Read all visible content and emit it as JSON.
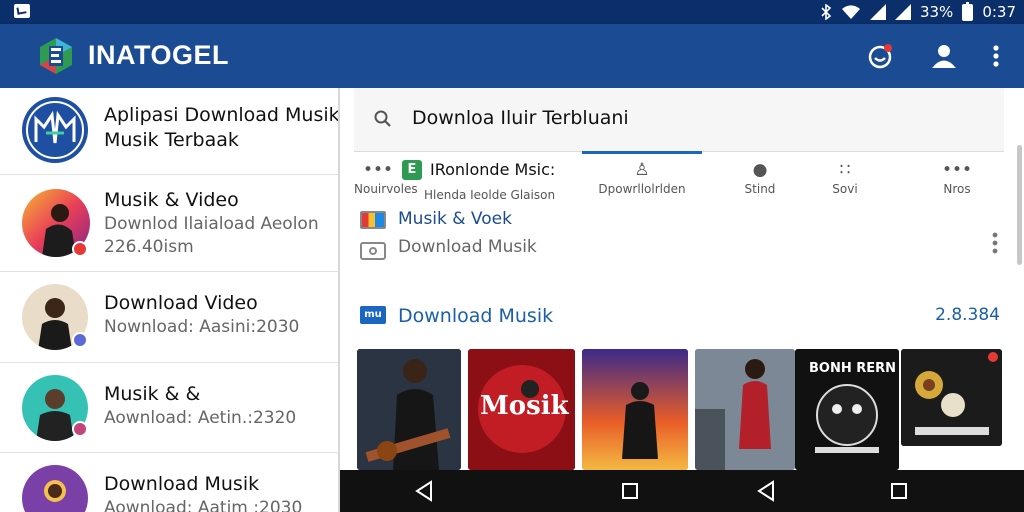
{
  "status_bar": {
    "battery_text": "33%",
    "time": "0:37"
  },
  "app_bar": {
    "title": "INATOGEL"
  },
  "list": [
    {
      "title": "Aplipasi Download Musik",
      "subtitle": "Musik Terbaak",
      "subtitle_line2": ""
    },
    {
      "title": "Musik & Video",
      "subtitle": "Downlod Ilaiaload Aeolon",
      "subtitle_line2": "226.40ism"
    },
    {
      "title": "Download Video",
      "subtitle": "Nownload: Aasini:2030",
      "subtitle_line2": ""
    },
    {
      "title": "Musik & &",
      "subtitle": "Aownload: Aetin.:2320",
      "subtitle_line2": ""
    },
    {
      "title": "Download Musik",
      "subtitle": "Aownload: Aatim :2030",
      "subtitle_line2": ""
    }
  ],
  "search": {
    "text": "Downloa Iluir Terbluani"
  },
  "tabs": [
    {
      "icon": "more-dots-icon",
      "label": "Nouirvoles"
    },
    {
      "icon": "app-logo-icon",
      "label": "Hlenda Ieolde Glaison",
      "heading": "IRonlonde Msic:"
    },
    {
      "icon": "person-icon",
      "label": "Dpowrllolrlden"
    },
    {
      "icon": "mic-icon",
      "label": "Stind"
    },
    {
      "icon": "grid-icon",
      "label": "Sovi"
    },
    {
      "icon": "more-dots-icon",
      "label": "Nros"
    }
  ],
  "rows": [
    {
      "icon": "film-icon",
      "label": "Musik & Voek"
    },
    {
      "icon": "folder-icon",
      "label": "Download Musik"
    }
  ],
  "section": {
    "title": "Download Musik",
    "count": "2.8.384"
  },
  "thumbnails": [
    {
      "name": "guitarist-thumbnail",
      "caption": ""
    },
    {
      "name": "mosik-poster-thumbnail",
      "caption": "Mosik"
    },
    {
      "name": "singer-poster-thumbnail",
      "caption": ""
    },
    {
      "name": "performer-thumbnail",
      "caption": ""
    },
    {
      "name": "bonher-poster-thumbnail",
      "caption": "BONH RERN"
    },
    {
      "name": "flower-poster-thumbnail",
      "caption": ""
    }
  ],
  "colors": {
    "app_bar": "#1a4b93",
    "status_bar": "#0b2f6a",
    "accent": "#1a5fa8",
    "nav_bar": "#111111"
  }
}
